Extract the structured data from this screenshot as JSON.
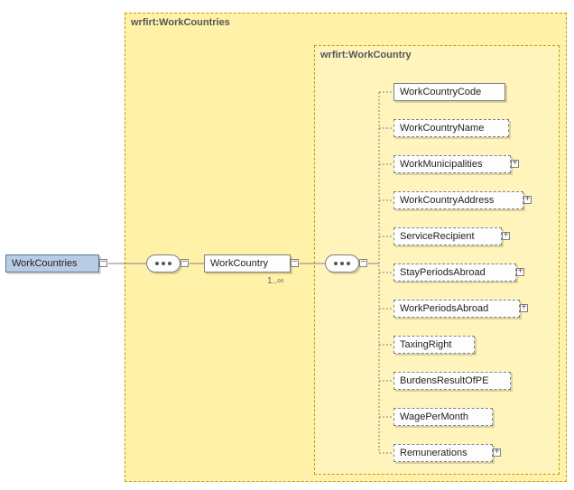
{
  "outerGroup": {
    "label": "wrfirt:WorkCountries"
  },
  "innerGroup": {
    "label": "wrfirt:WorkCountry"
  },
  "root": {
    "label": "WorkCountries"
  },
  "workCountry": {
    "label": "WorkCountry",
    "cardinality": "1..∞"
  },
  "children": [
    {
      "label": "WorkCountryCode",
      "optional": false,
      "expandable": false
    },
    {
      "label": "WorkCountryName",
      "optional": true,
      "expandable": false
    },
    {
      "label": "WorkMunicipalities",
      "optional": true,
      "expandable": true
    },
    {
      "label": "WorkCountryAddress",
      "optional": true,
      "expandable": true
    },
    {
      "label": "ServiceRecipient",
      "optional": true,
      "expandable": true
    },
    {
      "label": "StayPeriodsAbroad",
      "optional": true,
      "expandable": true
    },
    {
      "label": "WorkPeriodsAbroad",
      "optional": true,
      "expandable": true
    },
    {
      "label": "TaxingRight",
      "optional": true,
      "expandable": false
    },
    {
      "label": "BurdensResultOfPE",
      "optional": true,
      "expandable": false
    },
    {
      "label": "WagePerMonth",
      "optional": true,
      "expandable": false
    },
    {
      "label": "Remunerations",
      "optional": true,
      "expandable": true
    }
  ]
}
